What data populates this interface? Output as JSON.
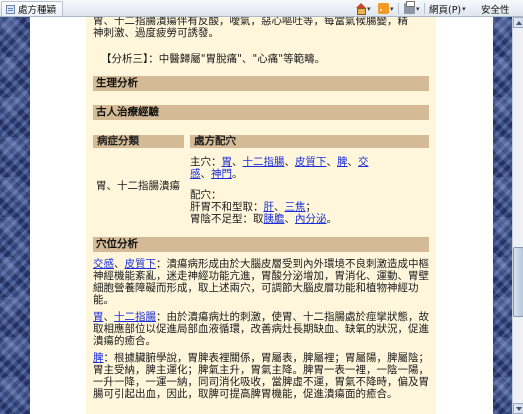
{
  "browser": {
    "tab_title": "處方種穎",
    "home_arrow": "▾",
    "feed_arrow": "▾",
    "print_arrow": "▾",
    "page_menu": "網頁(P)",
    "page_arrow": "▾",
    "safety_menu": "安全性"
  },
  "top_text": {
    "line1": "胃、十二指腸潰瘍伴有反酸，噯氣，惡心嘔吐等，每當氣候腸變，精",
    "line2": "神刺激、過度疲勞可誘發。",
    "analysis3": "【分析三】：中醫歸屬\"胃脫痛\"、\"心痛\"等範疇。"
  },
  "sections": {
    "physiology": "生理分析",
    "ancient": "古人治療經驗",
    "disease_class": "病症分類",
    "prescription": "處方配穴",
    "acupoint": "穴位分析"
  },
  "table": {
    "disease": "胃、十二指腸潰瘍",
    "main_label": "主穴：",
    "main_points": [
      "胃",
      "十二指腸",
      "皮質下",
      "脾",
      "交感",
      "神門"
    ],
    "sep": "、",
    "main_end": "。",
    "pair_label": "配穴：",
    "liver_prefix": "肝胃不和型取：",
    "liver_points": [
      "肝",
      "三焦"
    ],
    "liver_end": "；",
    "spleen_prefix": "胃陰不足型：取",
    "spleen_points": [
      "胰膽",
      "內分泌"
    ],
    "spleen_end": "。"
  },
  "acupoint_paras": {
    "p1_links": [
      "交感",
      "皮質下"
    ],
    "p1_rest": "：潰瘍病形成由於大腦皮層受到內外環境不良刺激造成中樞神經機能紊亂，迷走神經功能亢進，胃酸分泌增加，胃消化、運動、胃壁細胞營養障礙而形成，取上述兩穴，可調節大腦皮層功能和植物神經功能。",
    "p2_links": [
      "胃",
      "十二指腸"
    ],
    "p2_rest": "：由於潰瘍病灶的刺激，使胃、十二指腸處於痙攣狀態，故取相應部位以促進局部血液循環，改善病灶長期缺血、缺氧的狀況，促進潰瘍的癒合。",
    "p3_link": "脾",
    "p3_rest": "：根據臟腑學說，胃脾表裡關係，胃屬表，脾屬裡；胃屬陽，脾屬陰；胃主受納，脾主運化；脾氣主升，胃氣主降。脾胃一表一裡，一陰一陽，一升一降，一運一納，同司消化吸收，當脾虛不運，胃氣不降時，偏及胃腸可引起出血，因此，取脾可提高脾胃機能，促進潰瘍面的癒合。"
  }
}
